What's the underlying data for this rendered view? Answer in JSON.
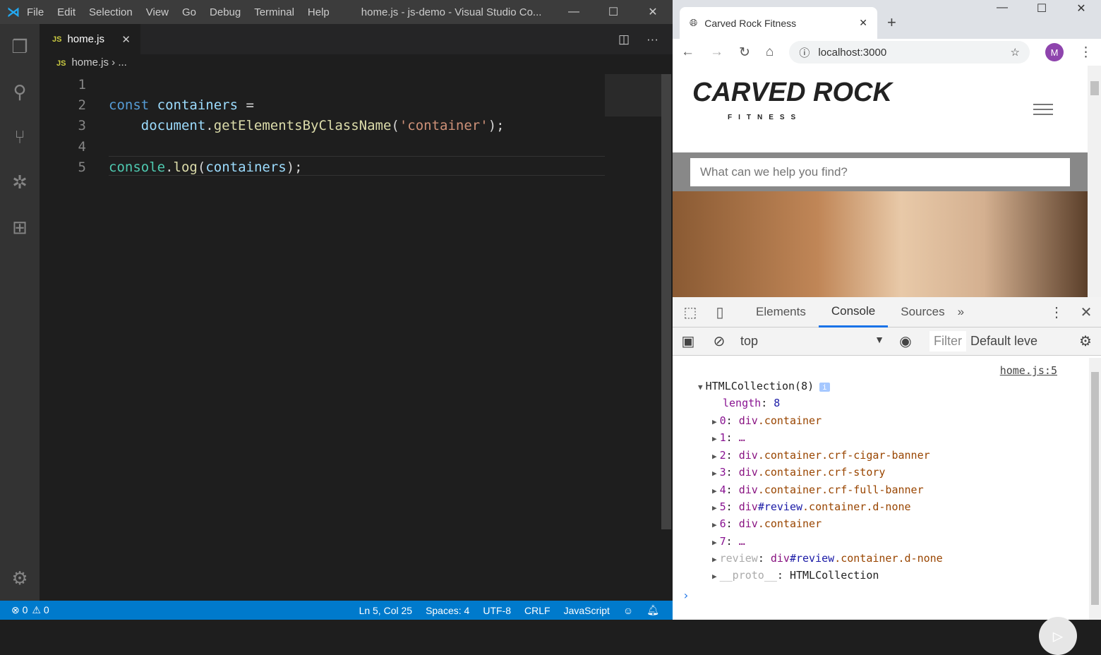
{
  "vscode": {
    "menu": [
      "File",
      "Edit",
      "Selection",
      "View",
      "Go",
      "Debug",
      "Terminal",
      "Help"
    ],
    "window_title": "home.js - js-demo - Visual Studio Co...",
    "tab": {
      "icon": "JS",
      "label": "home.js",
      "close": "✕"
    },
    "breadcrumb": {
      "file": "home.js",
      "sep": "›",
      "rest": "..."
    },
    "line_numbers": [
      "1",
      "2",
      "3",
      "4",
      "5"
    ],
    "code": {
      "l2": [
        "const",
        " containers",
        " ="
      ],
      "l3": [
        "    document",
        ".",
        "getElementsByClassName",
        "(",
        "'container'",
        ");"
      ],
      "l5": [
        "console",
        ".",
        "log",
        "(",
        "containers",
        ");"
      ]
    },
    "status": {
      "errors": "⊗ 0",
      "warnings": "⚠ 0",
      "position": "Ln 5, Col 25",
      "spaces": "Spaces: 4",
      "encoding": "UTF-8",
      "eol": "CRLF",
      "language": "JavaScript"
    }
  },
  "chrome": {
    "tab_title": "Carved Rock Fitness",
    "url": "localhost:3000",
    "avatar": "M",
    "site": {
      "logo_text": "CARVED ROCK",
      "logo_sub": "FITNESS",
      "search_placeholder": "What can we help you find?"
    },
    "devtools": {
      "tabs": [
        "Elements",
        "Console",
        "Sources"
      ],
      "more": "»",
      "context": "top",
      "filter": "Filter",
      "levels": "Default leve",
      "source_link": "home.js:5",
      "collection": "HTMLCollection(8)",
      "info": "i",
      "length_key": "length",
      "length_val": "8",
      "items": [
        {
          "k": "0",
          "tag": "div",
          "id": "",
          "cls": ".container"
        },
        {
          "k": "1",
          "tag": "…",
          "id": "",
          "cls": ""
        },
        {
          "k": "2",
          "tag": "div",
          "id": "",
          "cls": ".container.crf-cigar-banner"
        },
        {
          "k": "3",
          "tag": "div",
          "id": "",
          "cls": ".container.crf-story"
        },
        {
          "k": "4",
          "tag": "div",
          "id": "",
          "cls": ".container.crf-full-banner"
        },
        {
          "k": "5",
          "tag": "div",
          "id": "#review",
          "cls": ".container.d-none"
        },
        {
          "k": "6",
          "tag": "div",
          "id": "",
          "cls": ".container"
        },
        {
          "k": "7",
          "tag": "…",
          "id": "",
          "cls": ""
        },
        {
          "k": "review",
          "tag": "div",
          "id": "#review",
          "cls": ".container.d-none"
        }
      ],
      "proto_key": "__proto__",
      "proto_val": "HTMLCollection",
      "prompt": "›"
    }
  }
}
